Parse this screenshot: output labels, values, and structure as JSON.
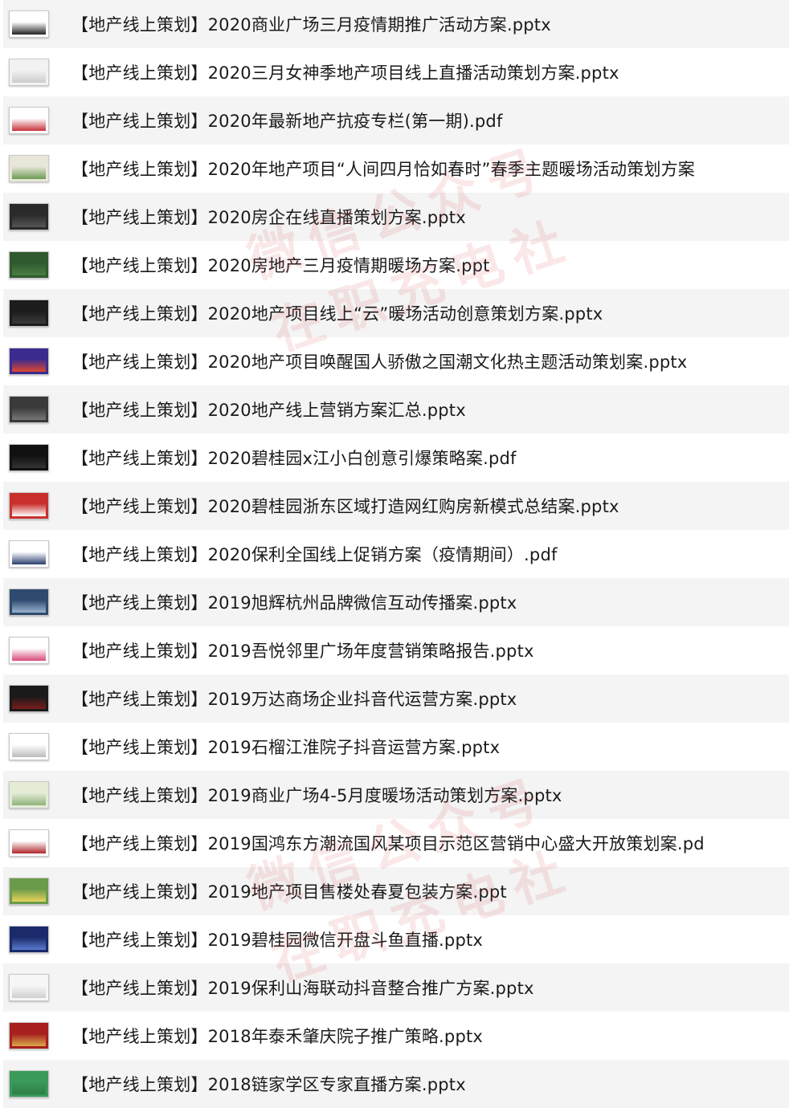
{
  "files": [
    {
      "name": "【地产线上策划】2020商业广场三月疫情期推广活动方案.pptx",
      "thumb": {
        "bg": "#ffffff",
        "accent": "#222222"
      }
    },
    {
      "name": "【地产线上策划】2020三月女神季地产项目线上直播活动策划方案.pptx",
      "thumb": {
        "bg": "#f2f2f2",
        "accent": "#cccccc"
      }
    },
    {
      "name": "【地产线上策划】2020年最新地产抗疫专栏(第一期).pdf",
      "thumb": {
        "bg": "#ffffff",
        "accent": "#c8333a"
      }
    },
    {
      "name": "【地产线上策划】2020年地产项目“人间四月恰如春时”春季主题暖场活动策划方案",
      "thumb": {
        "bg": "#e8e6d8",
        "accent": "#6c9b55"
      }
    },
    {
      "name": "【地产线上策划】2020房企在线直播策划方案.pptx",
      "thumb": {
        "bg": "#2a2a2a",
        "accent": "#555555"
      }
    },
    {
      "name": "【地产线上策划】2020房地产三月疫情期暖场方案.ppt",
      "thumb": {
        "bg": "#2f5a2f",
        "accent": "#4a7d42"
      }
    },
    {
      "name": "【地产线上策划】2020地产项目线上“云”暖场活动创意策划方案.pptx",
      "thumb": {
        "bg": "#1c1c1c",
        "accent": "#3a3a3a"
      }
    },
    {
      "name": "【地产线上策划】2020地产项目唤醒国人骄傲之国潮文化热主题活动策划案.pptx",
      "thumb": {
        "bg": "#3b2b8f",
        "accent": "#e0482e"
      }
    },
    {
      "name": "【地产线上策划】2020地产线上营销方案汇总.pptx",
      "thumb": {
        "bg": "#3a3a3a",
        "accent": "#777777"
      }
    },
    {
      "name": "【地产线上策划】2020碧桂园x江小白创意引爆策略案.pdf",
      "thumb": {
        "bg": "#111111",
        "accent": "#333333"
      }
    },
    {
      "name": "【地产线上策划】2020碧桂园浙东区域打造网红购房新模式总结案.pptx",
      "thumb": {
        "bg": "#c9302c",
        "accent": "#ffffff"
      }
    },
    {
      "name": "【地产线上策划】2020保利全国线上促销方案（疫情期间）.pdf",
      "thumb": {
        "bg": "#ffffff",
        "accent": "#2a3e6e"
      }
    },
    {
      "name": "【地产线上策划】2019旭辉杭州品牌微信互动传播案.pptx",
      "thumb": {
        "bg": "#2e4a6e",
        "accent": "#9bb3d0"
      }
    },
    {
      "name": "【地产线上策划】2019吾悦邻里广场年度营销策略报告.pptx",
      "thumb": {
        "bg": "#ffffff",
        "accent": "#d94c7a"
      }
    },
    {
      "name": "【地产线上策划】2019万达商场企业抖音代运营方案.pptx",
      "thumb": {
        "bg": "#1a1a1a",
        "accent": "#7a1c1c"
      }
    },
    {
      "name": "【地产线上策划】2019石榴江淮院子抖音运营方案.pptx",
      "thumb": {
        "bg": "#ffffff",
        "accent": "#bbbbbb"
      }
    },
    {
      "name": "【地产线上策划】2019商业广场4-5月度暖场活动策划方案.pptx",
      "thumb": {
        "bg": "#e4ecd8",
        "accent": "#8fb27a"
      }
    },
    {
      "name": "【地产线上策划】2019国鸿东方潮流国风某项目示范区营销中心盛大开放策划案.pd",
      "thumb": {
        "bg": "#ffffff",
        "accent": "#b0282c"
      }
    },
    {
      "name": "【地产线上策划】2019地产项目售楼处春夏包装方案.ppt",
      "thumb": {
        "bg": "#6a9b4a",
        "accent": "#e8d35a"
      }
    },
    {
      "name": "【地产线上策划】2019碧桂园微信开盘斗鱼直播.pptx",
      "thumb": {
        "bg": "#1a2a6a",
        "accent": "#5a7ad0"
      }
    },
    {
      "name": "【地产线上策划】2019保利山海联动抖音整合推广方案.pptx",
      "thumb": {
        "bg": "#f6f6f6",
        "accent": "#d0d0d0"
      }
    },
    {
      "name": "【地产线上策划】2018年泰禾肇庆院子推广策略.pptx",
      "thumb": {
        "bg": "#a81f1f",
        "accent": "#d9a84a"
      }
    },
    {
      "name": "【地产线上策划】2018链家学区专家直播方案.pptx",
      "thumb": {
        "bg": "#3a9a5a",
        "accent": "#2e7d47"
      }
    }
  ],
  "watermarks": [
    {
      "line1": "微信公众号",
      "line2": "在职充电社"
    },
    {
      "line1": "微信公众号",
      "line2": "在职充电社"
    }
  ]
}
